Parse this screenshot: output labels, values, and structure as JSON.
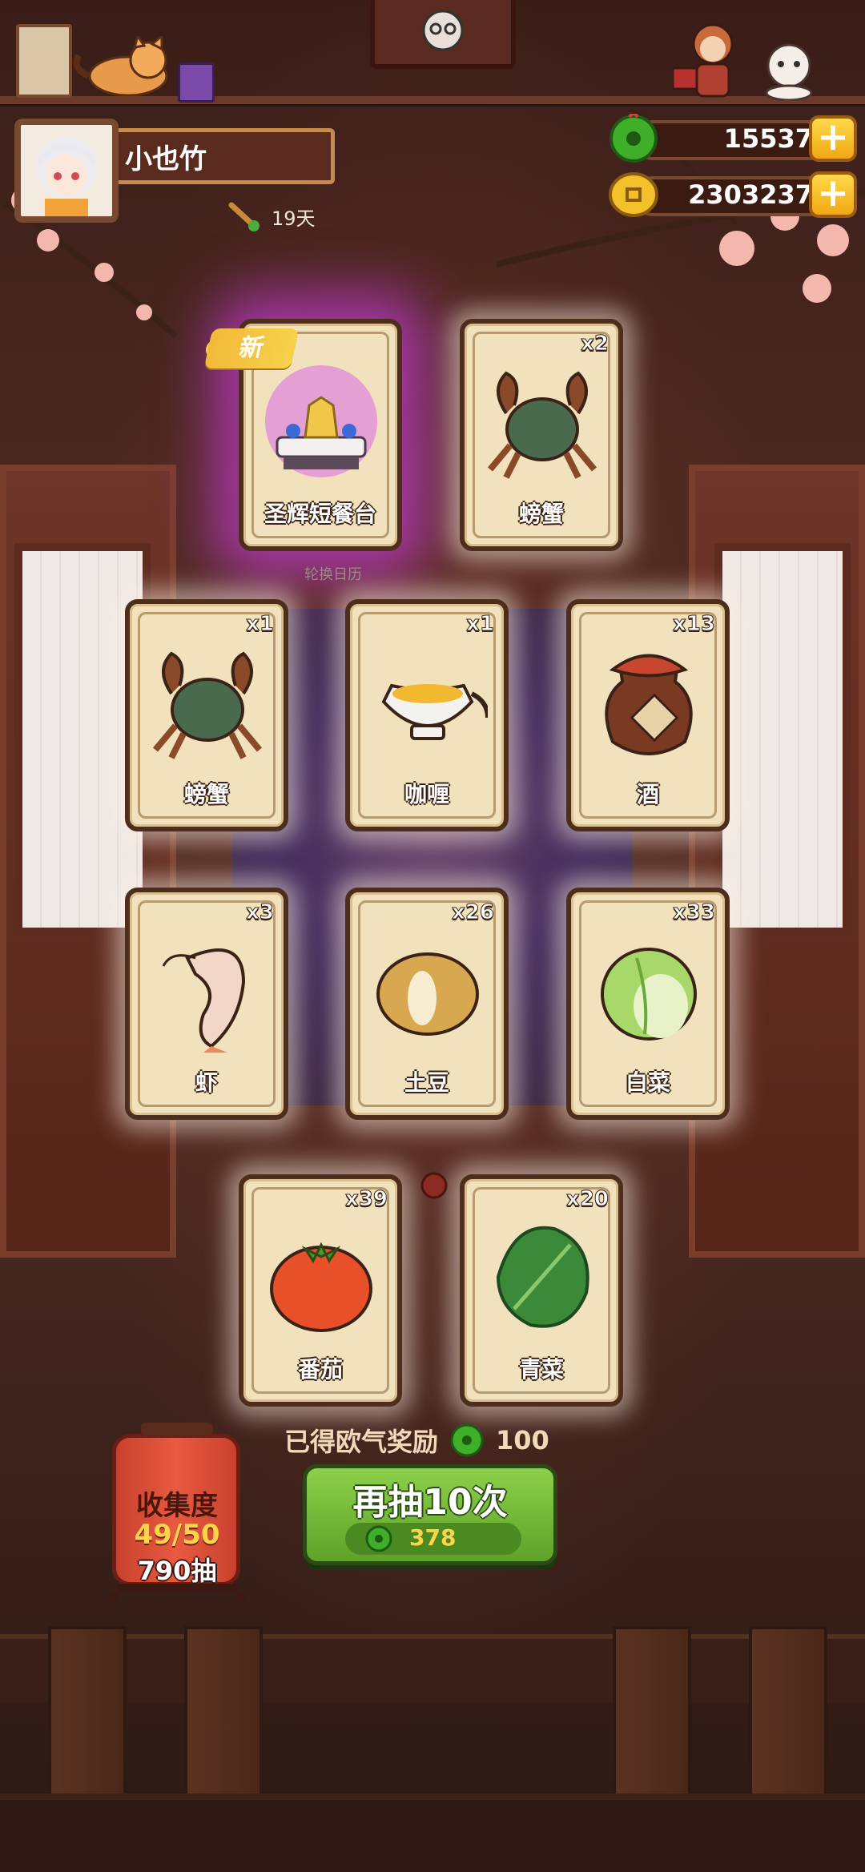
{
  "player": {
    "name": "小也竹",
    "days": "19天"
  },
  "currency": {
    "jade": "15537",
    "coins": "2303237"
  },
  "new_badge": "新",
  "calendar_label": "轮换日历",
  "cards": [
    {
      "label": "圣辉短餐台",
      "count": "",
      "is_new": true,
      "icon": "holy-table-icon"
    },
    {
      "label": "螃蟹",
      "count": "x2",
      "icon": "crab-icon"
    },
    {
      "label": "螃蟹",
      "count": "x1",
      "icon": "crab-icon"
    },
    {
      "label": "咖喱",
      "count": "x1",
      "icon": "curry-icon"
    },
    {
      "label": "酒",
      "count": "x13",
      "icon": "wine-jar-icon"
    },
    {
      "label": "虾",
      "count": "x3",
      "icon": "shrimp-icon"
    },
    {
      "label": "土豆",
      "count": "x26",
      "icon": "potato-icon"
    },
    {
      "label": "白菜",
      "count": "x33",
      "icon": "cabbage-icon"
    },
    {
      "label": "番茄",
      "count": "x39",
      "icon": "tomato-icon"
    },
    {
      "label": "青菜",
      "count": "x20",
      "icon": "greens-icon"
    }
  ],
  "reward": {
    "text": "已得欧气奖励",
    "amount": "100"
  },
  "collection": {
    "title": "收集度",
    "progress": "49/50",
    "draws": "790抽"
  },
  "draw_button": {
    "label": "再抽10次",
    "cost": "378"
  },
  "colors": {
    "jade_green": "#3fae2a",
    "button_green": "#6cb832",
    "gold": "#f2b12a"
  }
}
